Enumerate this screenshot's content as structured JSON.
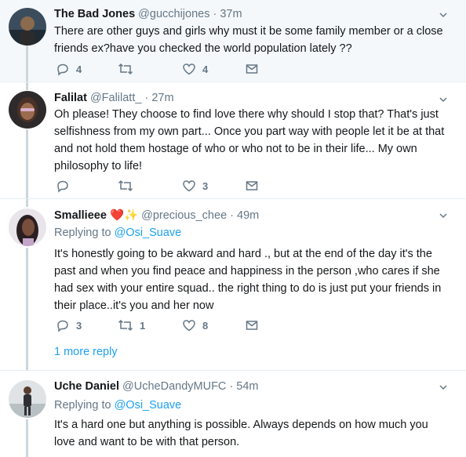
{
  "tweets": [
    {
      "name": "The Bad Jones",
      "handle": "@gucchijones",
      "time": "· 37m",
      "text": "There are other guys and girls why must it be some family member or a close friends ex?have you checked the world population lately ??",
      "replies": "4",
      "retweets": "",
      "likes": "4"
    },
    {
      "name": "Falilat",
      "handle": "@Falilatt_",
      "time": "· 27m",
      "text": "Oh please!  They choose to find love there why should I stop that? That's just selfishness from my own part... Once you part way with people let it be at that and not hold them hostage of who or who not to be in their life... My own philosophy to life!",
      "replies": "",
      "retweets": "",
      "likes": "3"
    },
    {
      "name": "Smallieee",
      "name_emoji": "❤️✨",
      "handle": "@precious_chee",
      "time": "· 49m",
      "replying_prefix": "Replying to",
      "replying_handle": "@Osi_Suave",
      "text": "It's honestly going to be akward and hard ., but at the end of the day it's the past and when you find peace and happiness in the person ,who cares if she had sex with your entire squad.. the right thing to do is just put your friends in their place..it's you and her now",
      "replies": "3",
      "retweets": "1",
      "likes": "8",
      "more_replies": "1 more reply"
    },
    {
      "name": "Uche Daniel",
      "handle": "@UcheDandyMUFC",
      "time": "· 54m",
      "replying_prefix": "Replying to",
      "replying_handle": "@Osi_Suave",
      "text": "It's a hard one but anything is possible. Always depends on how much you love and want to be with that person."
    }
  ],
  "icons": {
    "reply": "reply-icon",
    "retweet": "retweet-icon",
    "like": "heart-icon",
    "dm": "envelope-icon",
    "menu": "chevron-down-icon"
  },
  "colors": {
    "link": "#1da1f2",
    "muted": "#657786",
    "thread_line": "#ccd6dd",
    "highlight_bg": "#f5f8fa"
  }
}
